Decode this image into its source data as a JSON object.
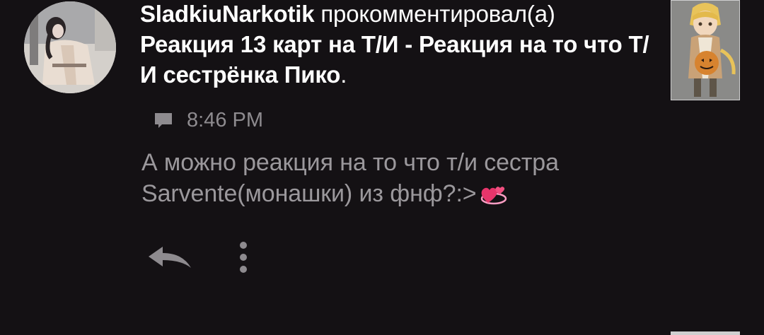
{
  "notification": {
    "username": "SladkiuNarkotik",
    "action": "прокомментировал(а)",
    "post_title": "Реакция 13 карт на Т/И - Реакция на то что Т/И сестрёнка Пико",
    "title_end": ".",
    "time": "8:46 PM",
    "comment_text": "А можно реакция на то что т/и сестра Sarvente(монашки) из фнф?:>",
    "comment_emoji": "revolving-hearts-emoji"
  },
  "icons": {
    "comment": "comment-icon",
    "reply": "reply-arrow-icon",
    "more": "more-vertical-icon"
  },
  "colors": {
    "background": "#141114",
    "primary_text": "#ffffff",
    "secondary_text": "#9b989c",
    "icon": "#8e8b8f"
  }
}
